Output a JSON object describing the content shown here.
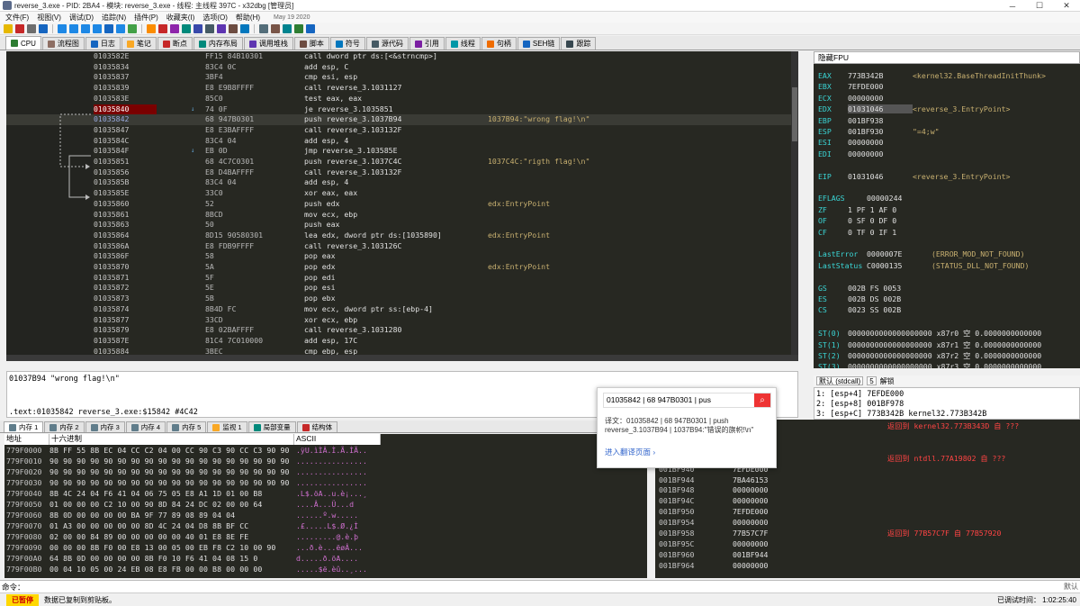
{
  "window": {
    "title": "reverse_3.exe - PID: 2BA4 - 模块: reverse_3.exe - 线程: 主线程 397C - x32dbg [管理员]",
    "min": "─",
    "max": "☐",
    "close": "✕"
  },
  "menu": [
    "文件(F)",
    "视图(V)",
    "调试(D)",
    "追踪(N)",
    "插件(P)",
    "收藏夹(I)",
    "选项(O)",
    "帮助(H)"
  ],
  "menu_date": "May 19 2020",
  "tabs": [
    {
      "label": "CPU",
      "color": "#2e7d32"
    },
    {
      "label": "流程图",
      "color": "#8d6e63"
    },
    {
      "label": "日志",
      "color": "#1565c0"
    },
    {
      "label": "笔记",
      "color": "#f9a825"
    },
    {
      "label": "断点",
      "color": "#c62828"
    },
    {
      "label": "内存布局",
      "color": "#00897b"
    },
    {
      "label": "调用堆栈",
      "color": "#5e35b1"
    },
    {
      "label": "脚本",
      "color": "#6d4c41"
    },
    {
      "label": "符号",
      "color": "#0277bd"
    },
    {
      "label": "源代码",
      "color": "#455a64"
    },
    {
      "label": "引用",
      "color": "#7b1fa2"
    },
    {
      "label": "线程",
      "color": "#0097a7"
    },
    {
      "label": "句柄",
      "color": "#ef6c00"
    },
    {
      "label": "SEH链",
      "color": "#1565c0"
    },
    {
      "label": "跟踪",
      "color": "#37474f"
    }
  ],
  "disasm": [
    {
      "addr": "0103582E",
      "hex": "FF15 84B10301",
      "ins": "call dword ptr ds:[<&strncmp>]",
      "cls": "c-call",
      "cm": ""
    },
    {
      "addr": "01035834",
      "hex": "83C4 0C",
      "ins": "add esp, C",
      "cls": "c-add",
      "cm": ""
    },
    {
      "addr": "01035837",
      "hex": "3BF4",
      "ins": "cmp esi, esp",
      "cls": "c-cmp",
      "cm": ""
    },
    {
      "addr": "01035839",
      "hex": "E8 E9B8FFFF",
      "ins": "call reverse_3.1031127",
      "cls": "c-call",
      "cm": ""
    },
    {
      "addr": "0103583E",
      "hex": "85C0",
      "ins": "test eax, eax",
      "cls": "c-test",
      "cm": ""
    },
    {
      "addr": "01035840",
      "hex": "74 0F",
      "ins": "je reverse_3.1035851",
      "cls": "c-je",
      "cm": "",
      "bp": true,
      "jm": "↓"
    },
    {
      "addr": "01035842",
      "hex": "68 947B0301",
      "ins": "push reverse_3.1037B94",
      "cls": "c-push",
      "cm": "1037B94:\"wrong flag!\\n\"",
      "cur": true
    },
    {
      "addr": "01035847",
      "hex": "E8 E3BAFFFF",
      "ins": "call reverse_3.103132F",
      "cls": "c-call",
      "cm": ""
    },
    {
      "addr": "0103584C",
      "hex": "83C4 04",
      "ins": "add esp, 4",
      "cls": "c-add",
      "cm": ""
    },
    {
      "addr": "0103584F",
      "hex": "EB 0D",
      "ins": "jmp reverse_3.103585E",
      "cls": "c-jmp",
      "cm": "",
      "jm": "↓"
    },
    {
      "addr": "01035851",
      "hex": "68 4C7C0301",
      "ins": "push reverse_3.1037C4C",
      "cls": "c-push",
      "cm": "1037C4C:\"rigth flag!\\n\""
    },
    {
      "addr": "01035856",
      "hex": "E8 D4BAFFFF",
      "ins": "call reverse_3.103132F",
      "cls": "c-call",
      "cm": ""
    },
    {
      "addr": "0103585B",
      "hex": "83C4 04",
      "ins": "add esp, 4",
      "cls": "c-add",
      "cm": ""
    },
    {
      "addr": "0103585E",
      "hex": "33C0",
      "ins": "xor eax, eax",
      "cls": "c-xor",
      "cm": ""
    },
    {
      "addr": "01035860",
      "hex": "52",
      "ins": "push edx",
      "cls": "c-push",
      "cm": "edx:EntryPoint"
    },
    {
      "addr": "01035861",
      "hex": "8BCD",
      "ins": "mov ecx, ebp",
      "cls": "c-mov",
      "cm": ""
    },
    {
      "addr": "01035863",
      "hex": "50",
      "ins": "push eax",
      "cls": "c-push",
      "cm": ""
    },
    {
      "addr": "01035864",
      "hex": "8D15 90580301",
      "ins": "lea edx, dword ptr ds:[1035890]",
      "cls": "c-lea",
      "cm": "edx:EntryPoint"
    },
    {
      "addr": "0103586A",
      "hex": "E8 FDB9FFFF",
      "ins": "call reverse_3.103126C",
      "cls": "c-call",
      "cm": ""
    },
    {
      "addr": "0103586F",
      "hex": "58",
      "ins": "pop eax",
      "cls": "c-pop",
      "cm": ""
    },
    {
      "addr": "01035870",
      "hex": "5A",
      "ins": "pop edx",
      "cls": "c-pop",
      "cm": "edx:EntryPoint"
    },
    {
      "addr": "01035871",
      "hex": "5F",
      "ins": "pop edi",
      "cls": "c-pop",
      "cm": ""
    },
    {
      "addr": "01035872",
      "hex": "5E",
      "ins": "pop esi",
      "cls": "c-pop",
      "cm": ""
    },
    {
      "addr": "01035873",
      "hex": "5B",
      "ins": "pop ebx",
      "cls": "c-pop",
      "cm": ""
    },
    {
      "addr": "01035874",
      "hex": "8B4D FC",
      "ins": "mov ecx, dword ptr ss:[ebp-4]",
      "cls": "c-mov",
      "cm": ""
    },
    {
      "addr": "01035877",
      "hex": "33CD",
      "ins": "xor ecx, ebp",
      "cls": "c-xor",
      "cm": ""
    },
    {
      "addr": "01035879",
      "hex": "E8 02BAFFFF",
      "ins": "call reverse_3.1031280",
      "cls": "c-call",
      "cm": ""
    },
    {
      "addr": "0103587E",
      "hex": "81C4 7C010000",
      "ins": "add esp, 17C",
      "cls": "c-add",
      "cm": ""
    },
    {
      "addr": "01035884",
      "hex": "3BEC",
      "ins": "cmp ebp, esp",
      "cls": "c-cmp",
      "cm": ""
    }
  ],
  "info": {
    "line1": "01037B94 \"wrong flag!\\n\"",
    "line2": ".text:01035842 reverse_3.exe:$15842 #4C42"
  },
  "regs": {
    "header": "隐藏FPU",
    "lines": [
      {
        "n": "EAX",
        "v": "773B342B",
        "c": "<kernel32.BaseThreadInitThunk>"
      },
      {
        "n": "EBX",
        "v": "7EFDE000",
        "c": ""
      },
      {
        "n": "ECX",
        "v": "00000000",
        "c": ""
      },
      {
        "n": "EDX",
        "v": "01031046",
        "c": "<reverse_3.EntryPoint>",
        "sel": true
      },
      {
        "n": "EBP",
        "v": "001BF938",
        "c": ""
      },
      {
        "n": "ESP",
        "v": "001BF930",
        "c": "\"=4;w\""
      },
      {
        "n": "ESI",
        "v": "00000000",
        "c": ""
      },
      {
        "n": "EDI",
        "v": "00000000",
        "c": ""
      },
      {
        "n": "",
        "v": "",
        "c": ""
      },
      {
        "n": "EIP",
        "v": "01031046",
        "c": "<reverse_3.EntryPoint>"
      },
      {
        "n": "",
        "v": "",
        "c": ""
      },
      {
        "n": "EFLAGS",
        "v": "00000244",
        "c": ""
      },
      {
        "n": "ZF",
        "v": "1  PF 1  AF 0",
        "c": ""
      },
      {
        "n": "OF",
        "v": "0  SF 0  DF 0",
        "c": ""
      },
      {
        "n": "CF",
        "v": "0  TF 0  IF 1",
        "c": ""
      },
      {
        "n": "",
        "v": "",
        "c": ""
      },
      {
        "n": "LastError",
        "v": "0000007E",
        "c": "(ERROR_MOD_NOT_FOUND)"
      },
      {
        "n": "LastStatus",
        "v": "C0000135",
        "c": "(STATUS_DLL_NOT_FOUND)"
      },
      {
        "n": "",
        "v": "",
        "c": ""
      },
      {
        "n": "GS",
        "v": "002B  FS 0053",
        "c": ""
      },
      {
        "n": "ES",
        "v": "002B  DS 002B",
        "c": ""
      },
      {
        "n": "CS",
        "v": "0023  SS 002B",
        "c": ""
      },
      {
        "n": "",
        "v": "",
        "c": ""
      },
      {
        "n": "ST(0)",
        "v": "0000000000000000000 x87r0 空 0.0000000000000",
        "c": ""
      },
      {
        "n": "ST(1)",
        "v": "0000000000000000000 x87r1 空 0.0000000000000",
        "c": ""
      },
      {
        "n": "ST(2)",
        "v": "0000000000000000000 x87r2 空 0.0000000000000",
        "c": ""
      },
      {
        "n": "ST(3)",
        "v": "0000000000000000000 x87r3 空 0.0000000000000",
        "c": ""
      }
    ]
  },
  "callconv": {
    "value": "默认 (stdcall)",
    "count": "5",
    "unlock": "解锁"
  },
  "args": [
    "1: [esp+4] 7EFDE000",
    "2: [esp+8] 001BF978",
    "3: [esp+C] 773B342B kernel32.773B342B"
  ],
  "dumptabs": [
    "内存 1",
    "内存 2",
    "内存 3",
    "内存 4",
    "内存 5",
    "监视 1",
    "局部变量",
    "结构体"
  ],
  "dump": {
    "h_addr": "地址",
    "h_hex": "十六进制",
    "h_ascii": "ASCII",
    "rows": [
      {
        "a": "779F0000",
        "x": "8B FF 55 8B EC 04 CC C2 04 00 CC 90 C3 90 CC C3 90 90",
        "c": ".ÿU.ìÌÂ.Ì.Ã.ÌÃ.."
      },
      {
        "a": "779F0010",
        "x": "90 90 90 90 90 90 90 90 90 90 90 90 90 90 90 90 90 90",
        "c": "................"
      },
      {
        "a": "779F0020",
        "x": "90 90 90 90 90 90 90 90 90 90 90 90 90 90 90 90 90 90",
        "c": "................"
      },
      {
        "a": "779F0030",
        "x": "90 90 90 90 90 90 90 90 90 90 90 90 90 90 90 90 90 90",
        "c": "................"
      },
      {
        "a": "779F0040",
        "x": "8B 4C 24 04 F6 41 04 06 75 05 E8 A1 1D 01 00 B8",
        "c": ".L$.öA..u.è¡...¸"
      },
      {
        "a": "779F0050",
        "x": "01 00 00 00 C2 10 00 90 8D 84 24 DC 02 00 00 64",
        "c": "....Â...Ü...d"
      },
      {
        "a": "779F0060",
        "x": "8B 0D 00 00 00 00 BA 9F 77 89 08 89 04 04",
        "c": "......º.w....."
      },
      {
        "a": "779F0070",
        "x": "01 A3 00 00 00 00 00 8D 4C 24 04 D8 8B BF CC",
        "c": ".£.....L$.Ø.¿Ì"
      },
      {
        "a": "779F0080",
        "x": "02 00 00 84 89 00 00 00 00 00 40 01 E8 8E FE",
        "c": ".........@.è.þ"
      },
      {
        "a": "779F0090",
        "x": "00 00 00 8B F0 00 E8 13 00 05 00 EB F8 C2 10 00 90",
        "c": "...ð.è...ëøÂ..."
      },
      {
        "a": "779F00A0",
        "x": "64 8B 0D 00 00 00 00 8B F0 10 F6 41 04 08 15 0",
        "c": "d.....ð.öA...."
      },
      {
        "a": "779F00B0",
        "x": "00 04 10 05 00 24 EB 08 E8 FB 00 00 B8 00 00 00",
        "c": ".....$ë.èû..¸..."
      }
    ]
  },
  "stack": [
    {
      "a": "001BF930",
      "v": "773B343D",
      "c": "返回到 kernel32.773B343D 自 ???"
    },
    {
      "a": "001BF934",
      "v": "7EFDE000",
      "c": ""
    },
    {
      "a": "001BF938",
      "v": "001BF978",
      "c": ""
    },
    {
      "a": "001BF93C",
      "v": "77A19802",
      "c": "返回到 ntdll.77A19802 自 ???"
    },
    {
      "a": "001BF940",
      "v": "7EFDE000",
      "c": ""
    },
    {
      "a": "001BF944",
      "v": "7BA46153",
      "c": ""
    },
    {
      "a": "001BF948",
      "v": "00000000",
      "c": ""
    },
    {
      "a": "001BF94C",
      "v": "00000000",
      "c": ""
    },
    {
      "a": "001BF950",
      "v": "7EFDE000",
      "c": ""
    },
    {
      "a": "001BF954",
      "v": "00000000",
      "c": ""
    },
    {
      "a": "001BF958",
      "v": "77B57C7F",
      "c": "返回到 77B57C7F 自 77B57920"
    },
    {
      "a": "001BF95C",
      "v": "00000000",
      "c": ""
    },
    {
      "a": "001BF960",
      "v": "001BF944",
      "c": ""
    },
    {
      "a": "001BF964",
      "v": "00000000",
      "c": ""
    }
  ],
  "popup": {
    "search": "01035842          | 68 947B0301       | pus",
    "translation": "译文：01035842 | 68 947B0301 | push reverse_3.1037B94 | 1037B94:\"错误的旗帜!\\n\"",
    "more": "进入翻译页面 ›"
  },
  "cmd": {
    "label": "命令：",
    "default": "默认"
  },
  "status": {
    "paused": "已暂停",
    "msg": "数据已复制到剪贴板。",
    "right": "已调试时间：  1:02:25:40"
  }
}
